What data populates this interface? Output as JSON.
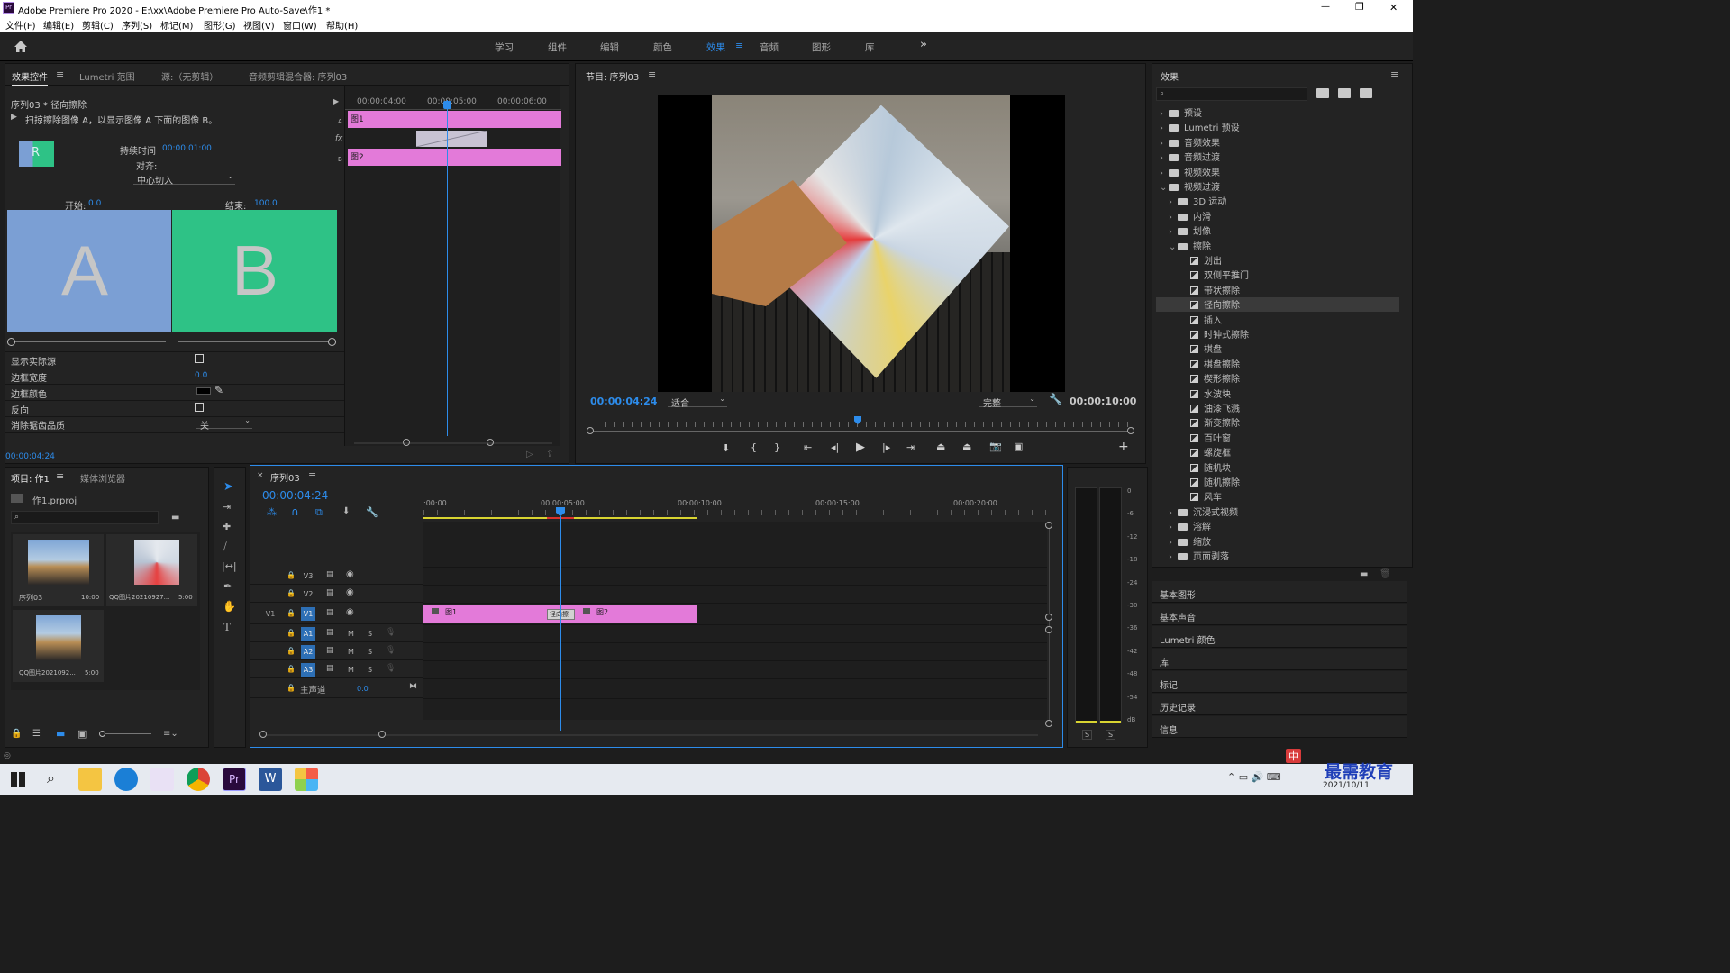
{
  "app": {
    "title": "Adobe Premiere Pro 2020 - E:\\xx\\Adobe Premiere Pro Auto-Save\\作1 *",
    "minimize": "—",
    "maximize": "❐",
    "close": "✕"
  },
  "menu": [
    "文件(F)",
    "编辑(E)",
    "剪辑(C)",
    "序列(S)",
    "标记(M)",
    "图形(G)",
    "视图(V)",
    "窗口(W)",
    "帮助(H)"
  ],
  "workspaces": [
    "学习",
    "组件",
    "编辑",
    "颜色",
    "效果",
    "音频",
    "图形",
    "库"
  ],
  "ws_active": "效果",
  "ws_more": "»",
  "effect_controls": {
    "tabs": [
      "效果控件",
      "Lumetri 范围",
      "源:（无剪辑）",
      "音频剪辑混合器: 序列03"
    ],
    "clip_title": "序列03 * 径向擦除",
    "description": "扫掠擦除图像 A，以显示图像 A 下面的图像 B。",
    "duration_label": "持续时间",
    "duration_value": "00:00:01:00",
    "align_label": "对齐:",
    "align_value": "中心切入",
    "start_label": "开始:",
    "start_value": "0.0",
    "end_label": "结束:",
    "end_value": "100.0",
    "letter_a": "A",
    "letter_b": "B",
    "thumb_letter": "R",
    "timecodes": [
      "00:00:04:00",
      "00:00:05:00",
      "00:00:06:00"
    ],
    "clip_a": "图1",
    "clip_b": "图2",
    "track_a": "A",
    "track_b": "B",
    "fx": "fx",
    "params": [
      {
        "label": "显示实际源"
      },
      {
        "label": "边框宽度",
        "value": "0.0"
      },
      {
        "label": "边框颜色"
      },
      {
        "label": "反向"
      },
      {
        "label": "消除锯齿品质",
        "value": "关"
      }
    ],
    "current_time": "00:00:04:24"
  },
  "program": {
    "title": "节目: 序列03",
    "timecode": "00:00:04:24",
    "fit": "适合",
    "quality": "完整",
    "duration": "00:00:10:00"
  },
  "effects": {
    "title": "效果",
    "items": [
      {
        "label": "预设",
        "type": "folder",
        "level": 0,
        "open": false
      },
      {
        "label": "Lumetri 预设",
        "type": "folder",
        "level": 0,
        "open": false
      },
      {
        "label": "音频效果",
        "type": "folder",
        "level": 0,
        "open": false
      },
      {
        "label": "音频过渡",
        "type": "folder",
        "level": 0,
        "open": false
      },
      {
        "label": "视频效果",
        "type": "folder",
        "level": 0,
        "open": false
      },
      {
        "label": "视频过渡",
        "type": "folder",
        "level": 0,
        "open": true
      },
      {
        "label": "3D 运动",
        "type": "folder",
        "level": 1,
        "open": false
      },
      {
        "label": "内滑",
        "type": "folder",
        "level": 1,
        "open": false
      },
      {
        "label": "划像",
        "type": "folder",
        "level": 1,
        "open": false
      },
      {
        "label": "擦除",
        "type": "folder",
        "level": 1,
        "open": true
      },
      {
        "label": "划出",
        "type": "effect",
        "level": 2
      },
      {
        "label": "双侧平推门",
        "type": "effect",
        "level": 2
      },
      {
        "label": "带状擦除",
        "type": "effect",
        "level": 2
      },
      {
        "label": "径向擦除",
        "type": "effect",
        "level": 2,
        "selected": true
      },
      {
        "label": "插入",
        "type": "effect",
        "level": 2
      },
      {
        "label": "时钟式擦除",
        "type": "effect",
        "level": 2
      },
      {
        "label": "棋盘",
        "type": "effect",
        "level": 2
      },
      {
        "label": "棋盘擦除",
        "type": "effect",
        "level": 2
      },
      {
        "label": "楔形擦除",
        "type": "effect",
        "level": 2
      },
      {
        "label": "水波块",
        "type": "effect",
        "level": 2
      },
      {
        "label": "油漆飞溅",
        "type": "effect",
        "level": 2
      },
      {
        "label": "渐变擦除",
        "type": "effect",
        "level": 2
      },
      {
        "label": "百叶窗",
        "type": "effect",
        "level": 2
      },
      {
        "label": "螺旋框",
        "type": "effect",
        "level": 2
      },
      {
        "label": "随机块",
        "type": "effect",
        "level": 2
      },
      {
        "label": "随机擦除",
        "type": "effect",
        "level": 2
      },
      {
        "label": "风车",
        "type": "effect",
        "level": 2
      },
      {
        "label": "沉浸式视频",
        "type": "folder",
        "level": 1,
        "open": false
      },
      {
        "label": "溶解",
        "type": "folder",
        "level": 1,
        "open": false
      },
      {
        "label": "缩放",
        "type": "folder",
        "level": 1,
        "open": false
      },
      {
        "label": "页面剥落",
        "type": "folder",
        "level": 1,
        "open": false
      }
    ],
    "sections": [
      "基本图形",
      "基本声音",
      "Lumetri 颜色",
      "库",
      "标记",
      "历史记录",
      "信息"
    ]
  },
  "project": {
    "tabs": [
      "项目: 作1",
      "媒体浏览器"
    ],
    "file": "作1.prproj",
    "items": [
      {
        "name": "序列03",
        "duration": "10:00"
      },
      {
        "name": "QQ图片20210927...",
        "duration": "5:00"
      },
      {
        "name": "QQ图片2021092...",
        "duration": "5:00"
      }
    ]
  },
  "timeline": {
    "tab": "序列03",
    "timecode": "00:00:04:24",
    "ruler": [
      ":00:00",
      "00:00:05:00",
      "00:00:10:00",
      "00:00:15:00",
      "00:00:20:00"
    ],
    "video_tracks": [
      "V3",
      "V2",
      "V1"
    ],
    "audio_tracks": [
      "A1",
      "A2",
      "A3"
    ],
    "source_patch": "V1",
    "master": "主声道",
    "master_value": "0.0",
    "clip1": "图1",
    "clip2": "图2",
    "transition": "径向擦",
    "btn_m": "M",
    "btn_s": "S"
  },
  "meter": {
    "scale": [
      "0",
      "-6",
      "-12",
      "-18",
      "-24",
      "-30",
      "-36",
      "-42",
      "-48",
      "-54",
      "dB"
    ],
    "solo": "S"
  },
  "taskbar": {
    "clock": "2021/10/11",
    "watermark": "最需教育",
    "ime": "中"
  },
  "colors": {
    "accent": "#2d8ceb",
    "clip": "#e37ad9",
    "a": "#7b9fd4",
    "b": "#2ec286"
  }
}
